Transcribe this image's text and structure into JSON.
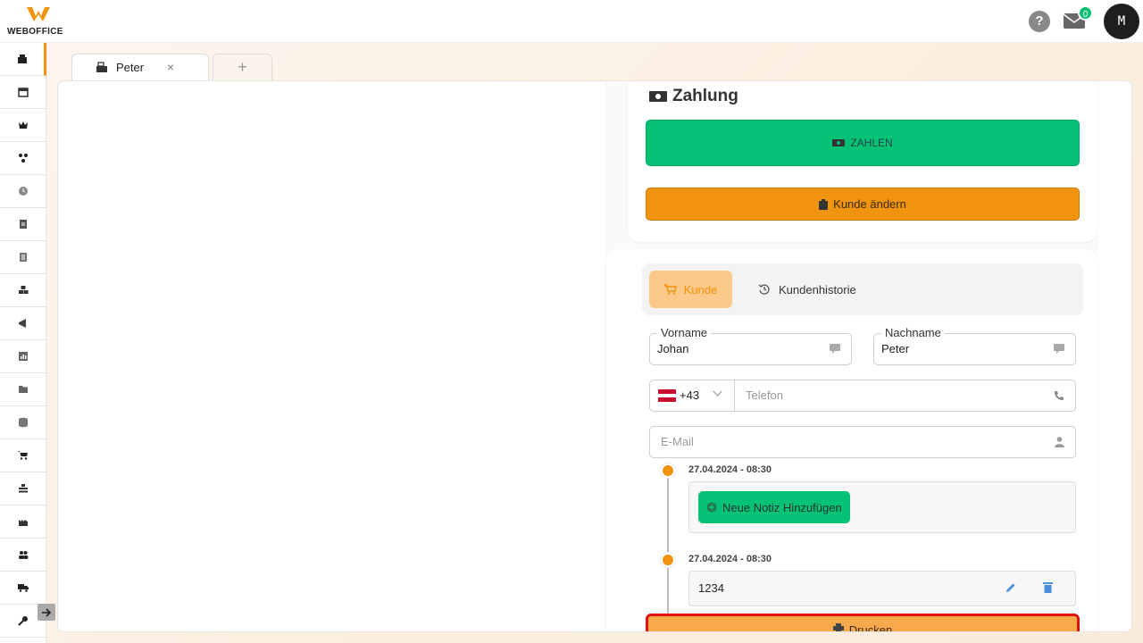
{
  "header": {
    "brand": "WEBOFFICE",
    "help_label": "?",
    "mail_count": "0",
    "avatar_initial": "M"
  },
  "sidebar": {
    "items": [
      {
        "icon": "cash-register-icon"
      },
      {
        "icon": "calendar-icon"
      },
      {
        "icon": "crown-icon"
      },
      {
        "icon": "network-icon"
      },
      {
        "icon": "clock-icon"
      },
      {
        "icon": "document-icon"
      },
      {
        "icon": "list-icon"
      },
      {
        "icon": "boxes-icon"
      },
      {
        "icon": "megaphone-icon"
      },
      {
        "icon": "chart-icon"
      },
      {
        "icon": "folder-icon"
      },
      {
        "icon": "database-icon"
      },
      {
        "icon": "cart-icon"
      },
      {
        "icon": "inventory-icon"
      },
      {
        "icon": "factory-icon"
      },
      {
        "icon": "users-icon"
      },
      {
        "icon": "truck-icon"
      },
      {
        "icon": "key-icon"
      }
    ]
  },
  "tabs": {
    "active_label": "Peter",
    "close_label": "×",
    "add_label": "+"
  },
  "payment": {
    "title": "Zahlung",
    "pay_label": "ZAHLEN",
    "change_customer_label": "Kunde ändern"
  },
  "customer": {
    "tab_customer": "Kunde",
    "tab_history": "Kundenhistorie",
    "first_name_label": "Vorname",
    "first_name_value": "Johan",
    "last_name_label": "Nachname",
    "last_name_value": "Peter",
    "country_code": "+43",
    "phone_placeholder": "Telefon",
    "email_placeholder": "E-Mail"
  },
  "timeline": [
    {
      "date": "27.04.2024 - 08:30",
      "action_label": "Neue Notiz Hinzufügen"
    },
    {
      "date": "27.04.2024 - 08:30",
      "note": "1234"
    }
  ],
  "print_label": "Drucken",
  "colors": {
    "accent": "#f0930e",
    "success": "#05c276",
    "highlight_border": "#e01313"
  }
}
